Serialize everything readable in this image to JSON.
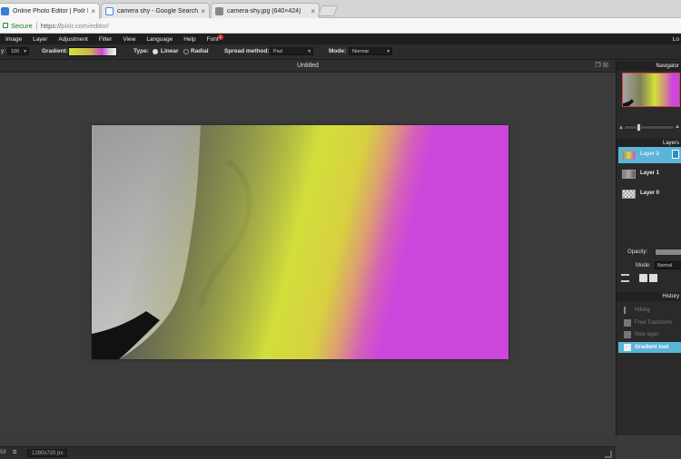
{
  "browser": {
    "tabs": [
      {
        "label": "Online Photo Editor | Pixlr Edito",
        "active": true
      },
      {
        "label": "camera shy - Google Search",
        "active": false
      },
      {
        "label": "camera-shy.jpg (640×424)",
        "active": false
      }
    ],
    "secure_label": "Secure",
    "url_proto": "https://",
    "url_rest": "pixlr.com/editor/"
  },
  "menu": {
    "items": [
      "Image",
      "Layer",
      "Adjustment",
      "Filter",
      "View",
      "Language",
      "Help",
      "Font"
    ],
    "font_badge": "1",
    "login": "Lo"
  },
  "options": {
    "opacity_value": "100",
    "gradient_label": "Gradient:",
    "type_label": "Type:",
    "linear_label": "Linear",
    "radial_label": "Radial",
    "spread_label": "Spread method:",
    "spread_value": "Pad",
    "mode_label": "Mode:",
    "mode_value": "Normal",
    "selected_type": "Linear"
  },
  "document": {
    "title": "Untitled",
    "size_label": "1280x720 px",
    "zoom_value": "58"
  },
  "panels": {
    "navigator_title": "Navigator",
    "layers_title": "Layers",
    "layers": [
      {
        "name": "Layer 2",
        "selected": true
      },
      {
        "name": "Layer 1",
        "selected": false
      },
      {
        "name": "Layer 0",
        "selected": false
      }
    ],
    "opacity_label": "Opacity:",
    "mode_label": "Mode:",
    "mode_value": "Normal",
    "history_title": "History",
    "history": [
      {
        "label": "Hiking",
        "selected": false
      },
      {
        "label": "Free Transform",
        "selected": false
      },
      {
        "label": "New layer",
        "selected": false
      },
      {
        "label": "Gradient tool",
        "selected": true
      }
    ]
  },
  "colors": {
    "accent": "#5ab5d8",
    "gradient_start": "#d4e23a",
    "gradient_end": "#cf45d8"
  }
}
